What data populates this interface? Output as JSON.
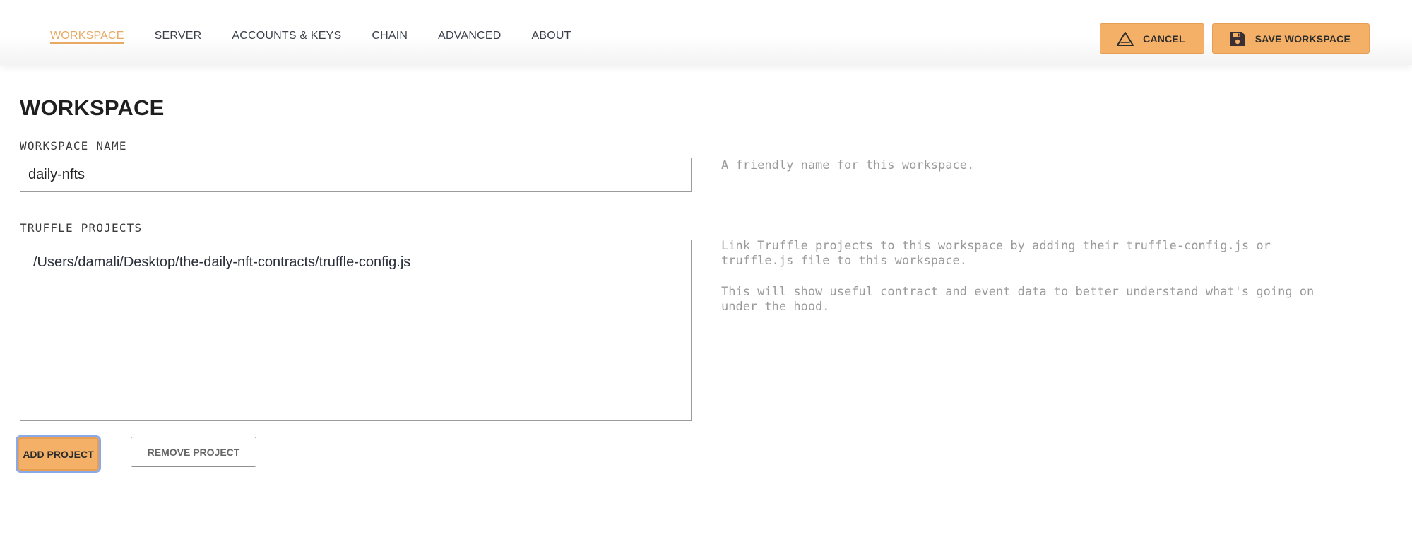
{
  "nav": {
    "items": [
      {
        "label": "WORKSPACE",
        "active": true
      },
      {
        "label": "SERVER",
        "active": false
      },
      {
        "label": "ACCOUNTS & KEYS",
        "active": false
      },
      {
        "label": "CHAIN",
        "active": false
      },
      {
        "label": "ADVANCED",
        "active": false
      },
      {
        "label": "ABOUT",
        "active": false
      }
    ]
  },
  "actions": {
    "cancel_label": "CANCEL",
    "cancel_icon": "warning-triangle-icon",
    "save_label": "SAVE WORKSPACE",
    "save_icon": "floppy-disk-icon"
  },
  "page": {
    "title": "WORKSPACE"
  },
  "workspace_name": {
    "label": "WORKSPACE NAME",
    "value": "daily-nfts",
    "help": "A friendly name for this workspace."
  },
  "truffle_projects": {
    "label": "TRUFFLE PROJECTS",
    "items": [
      "/Users/damali/Desktop/the-daily-nft-contracts/truffle-config.js"
    ],
    "help_1": "Link Truffle projects to this workspace by adding their truffle-config.js or\ntruffle.js file to this workspace.",
    "help_2": "This will show useful contract and event data to better understand what's going on\nunder the hood.",
    "add_label": "ADD PROJECT",
    "remove_label": "REMOVE PROJECT"
  },
  "colors": {
    "accent": "#f3b066",
    "active_tab": "#e7a964",
    "focus_ring": "#8aa9e8"
  }
}
